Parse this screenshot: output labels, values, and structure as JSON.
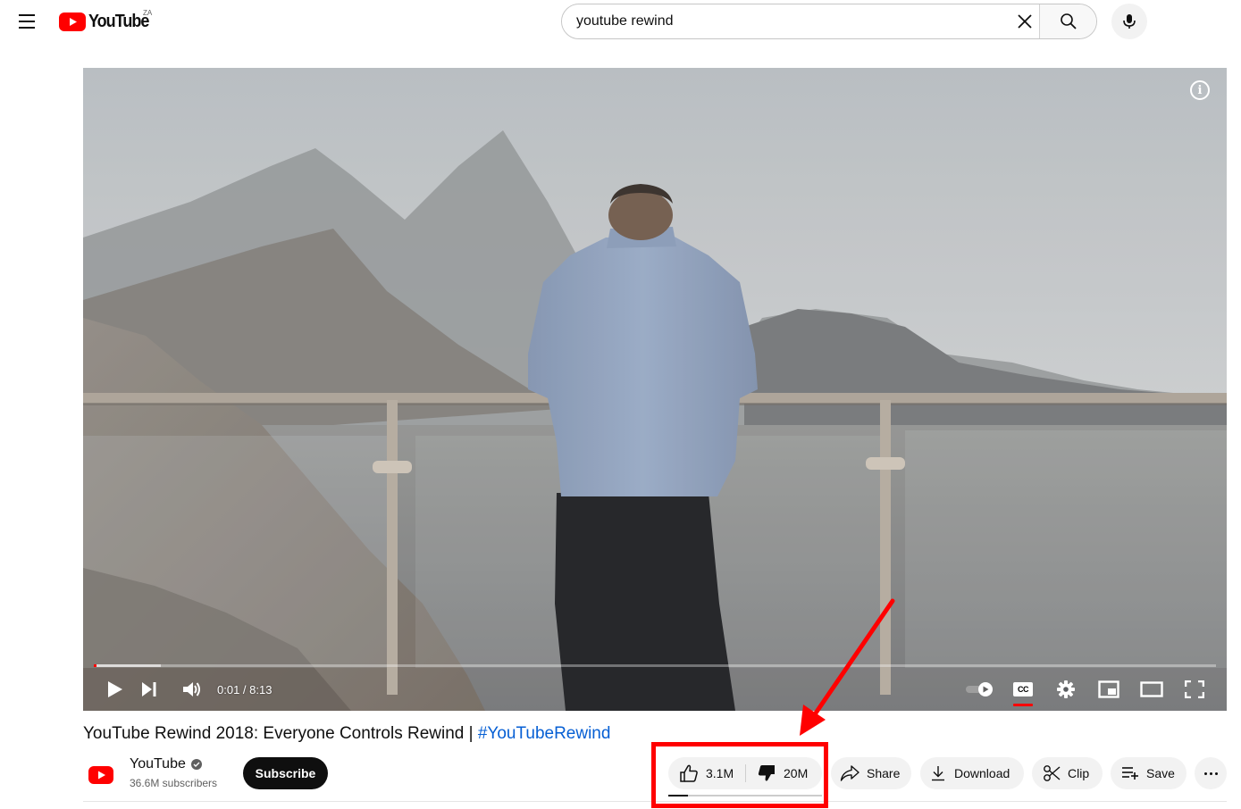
{
  "masthead": {
    "logo_text": "YouTube",
    "country_code": "ZA",
    "search_value": "youtube rewind",
    "icons": [
      "menu-icon",
      "youtube-logo-icon",
      "clear-icon",
      "search-icon",
      "microphone-icon"
    ]
  },
  "player": {
    "time_display": "0:01 / 8:13",
    "played_fraction": 0.002,
    "buffered_fraction": 0.06,
    "cc_label": "CC",
    "info_label": "i",
    "icons": [
      "play-icon",
      "next-icon",
      "volume-icon",
      "autoplay-toggle-icon",
      "subtitles-icon",
      "settings-gear-icon",
      "miniplayer-icon",
      "theater-mode-icon",
      "fullscreen-icon"
    ]
  },
  "video": {
    "title_main": "YouTube Rewind 2018: Everyone Controls Rewind | ",
    "title_hashtag": "#YouTubeRewind"
  },
  "channel": {
    "name": "YouTube",
    "subscribers": "36.6M subscribers",
    "subscribe_label": "Subscribe",
    "verified": true
  },
  "actions": {
    "likes": "3.1M",
    "dislikes": "20M",
    "like_ratio_fraction": 0.13,
    "share_label": "Share",
    "download_label": "Download",
    "clip_label": "Clip",
    "save_label": "Save"
  },
  "annotation": {
    "highlight_color": "#ff0000"
  },
  "colors": {
    "brand_red": "#ff0000",
    "hashtag_blue": "#065fd4",
    "pill_bg": "#f2f2f2",
    "text_primary": "#0f0f0f",
    "text_secondary": "#606060"
  }
}
